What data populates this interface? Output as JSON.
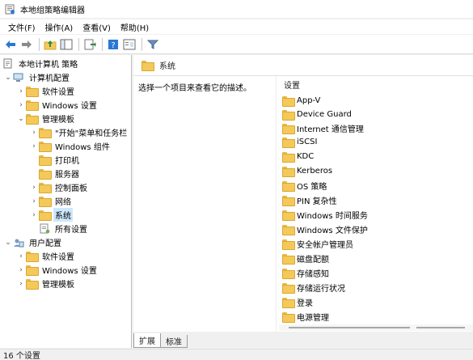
{
  "window": {
    "title": "本地组策略编辑器"
  },
  "menu": [
    {
      "label": "文件(F)"
    },
    {
      "label": "操作(A)"
    },
    {
      "label": "查看(V)"
    },
    {
      "label": "帮助(H)"
    }
  ],
  "tree": {
    "root": "本地计算机 策略",
    "computer_config": "计算机配置",
    "software_settings": "软件设置",
    "windows_settings": "Windows 设置",
    "admin_templates": "管理模板",
    "start_menu": "\"开始\"菜单和任务栏",
    "windows_components": "Windows 组件",
    "printers": "打印机",
    "server": "服务器",
    "control_panel": "控制面板",
    "network": "网络",
    "system": "系统",
    "all_settings": "所有设置",
    "user_config": "用户配置",
    "user_software_settings": "软件设置",
    "user_windows_settings": "Windows 设置",
    "user_admin_templates": "管理模板"
  },
  "right_pane": {
    "header": "系统",
    "description": "选择一个项目来查看它的描述。",
    "column_header": "设置",
    "items": [
      "App-V",
      "Device Guard",
      "Internet 通信管理",
      "iSCSI",
      "KDC",
      "Kerberos",
      "OS 策略",
      "PIN 复杂性",
      "Windows 时间服务",
      "Windows 文件保护",
      "安全帐户管理员",
      "磁盘配额",
      "存储感知",
      "存储运行状况",
      "登录",
      "电源管理"
    ]
  },
  "tabs": {
    "extended": "扩展",
    "standard": "标准"
  },
  "status": {
    "text": "16 个设置"
  },
  "colors": {
    "selected_bg": "#cce8ff",
    "folder": "#f5c85a"
  }
}
